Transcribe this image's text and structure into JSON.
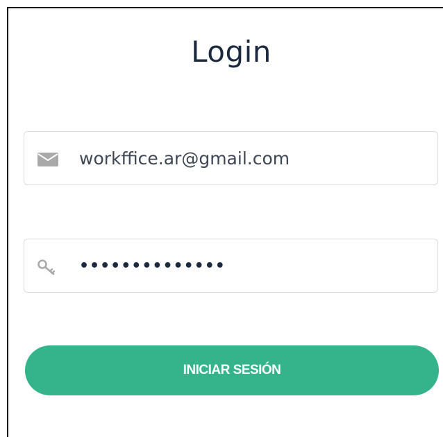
{
  "page": {
    "title": "Login"
  },
  "form": {
    "email": {
      "value": "workffice.ar@gmail.com",
      "icon": "envelope-icon"
    },
    "password": {
      "value": "••••••••••••••",
      "icon": "key-icon"
    },
    "submit_label": "INICIAR SESIÓN"
  },
  "colors": {
    "accent": "#35b38b",
    "title": "#1b2a3f",
    "border": "#dcdcdc",
    "icon": "#a9a9a9"
  }
}
